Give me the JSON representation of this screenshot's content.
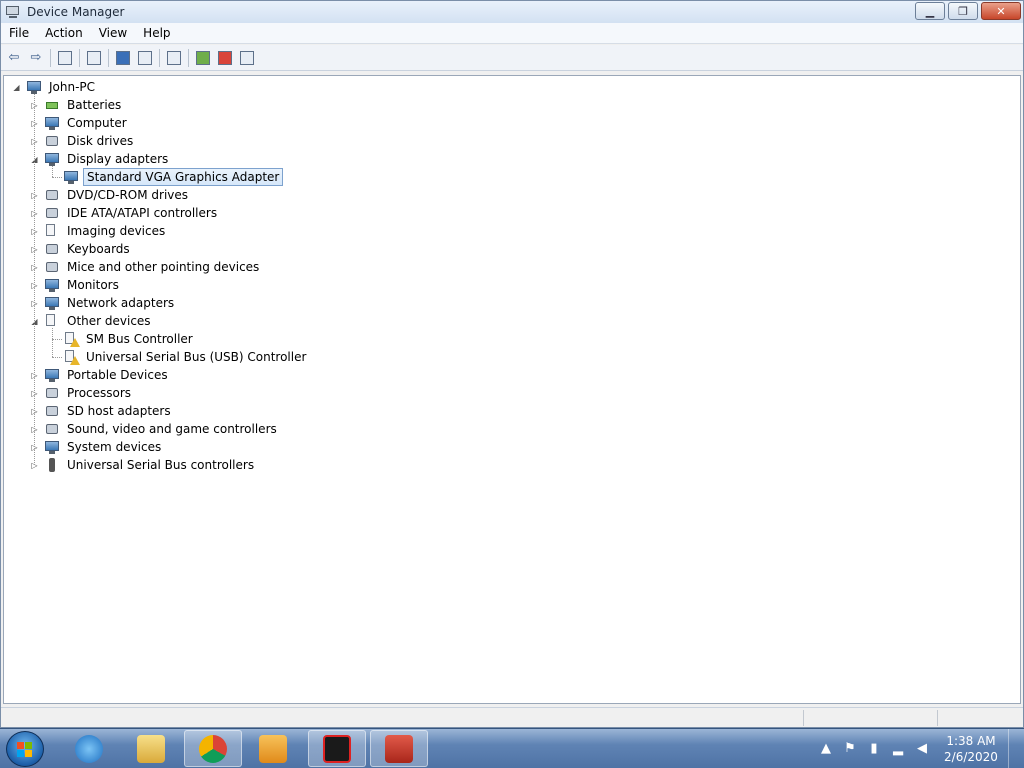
{
  "window": {
    "title": "Device Manager",
    "controls": {
      "minimize": "▁",
      "restore": "❐",
      "close": "✕"
    }
  },
  "menu": [
    "File",
    "Action",
    "View",
    "Help"
  ],
  "toolbar": {
    "back": "⇦",
    "forward": "⇨"
  },
  "tree": {
    "root": "John-PC",
    "items": [
      {
        "label": "Batteries",
        "icon": "battery-icon",
        "expanded": false
      },
      {
        "label": "Computer",
        "icon": "computer-icon",
        "expanded": false
      },
      {
        "label": "Disk drives",
        "icon": "disk-drive-icon",
        "expanded": false
      },
      {
        "label": "Display adapters",
        "icon": "display-adapter-icon",
        "expanded": true,
        "children": [
          {
            "label": "Standard VGA Graphics Adapter",
            "icon": "display-adapter-icon",
            "selected": true
          }
        ]
      },
      {
        "label": "DVD/CD-ROM drives",
        "icon": "dvd-drive-icon",
        "expanded": false
      },
      {
        "label": "IDE ATA/ATAPI controllers",
        "icon": "ide-controller-icon",
        "expanded": false
      },
      {
        "label": "Imaging devices",
        "icon": "imaging-device-icon",
        "expanded": false
      },
      {
        "label": "Keyboards",
        "icon": "keyboard-icon",
        "expanded": false
      },
      {
        "label": "Mice and other pointing devices",
        "icon": "mouse-icon",
        "expanded": false
      },
      {
        "label": "Monitors",
        "icon": "monitor-icon",
        "expanded": false
      },
      {
        "label": "Network adapters",
        "icon": "network-adapter-icon",
        "expanded": false
      },
      {
        "label": "Other devices",
        "icon": "other-devices-icon",
        "expanded": true,
        "children": [
          {
            "label": "SM Bus Controller",
            "icon": "warning-device-icon"
          },
          {
            "label": "Universal Serial Bus (USB) Controller",
            "icon": "warning-device-icon"
          }
        ]
      },
      {
        "label": "Portable Devices",
        "icon": "portable-device-icon",
        "expanded": false
      },
      {
        "label": "Processors",
        "icon": "processor-icon",
        "expanded": false
      },
      {
        "label": "SD host adapters",
        "icon": "sd-adapter-icon",
        "expanded": false
      },
      {
        "label": "Sound, video and game controllers",
        "icon": "sound-icon",
        "expanded": false
      },
      {
        "label": "System devices",
        "icon": "system-device-icon",
        "expanded": false
      },
      {
        "label": "Universal Serial Bus controllers",
        "icon": "usb-icon",
        "expanded": false
      }
    ]
  },
  "taskbar": {
    "apps": [
      "internet-explorer-icon",
      "file-explorer-icon",
      "chrome-icon",
      "media-player-icon",
      "garena-icon",
      "toolbox-icon"
    ],
    "clock": {
      "time": "1:38 AM",
      "date": "2/6/2020"
    }
  },
  "colors": {
    "selection": "#d6e7f9",
    "taskbar": "#4f73a5"
  }
}
